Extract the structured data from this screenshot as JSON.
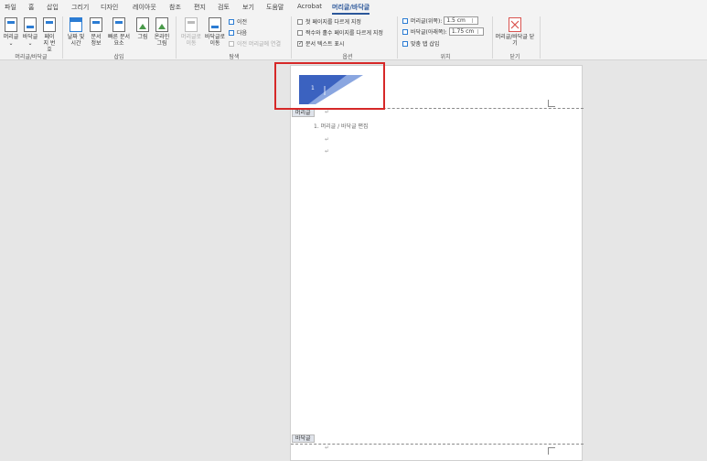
{
  "tabs": [
    "파일",
    "홈",
    "삽입",
    "그리기",
    "디자인",
    "레이아웃",
    "참조",
    "편지",
    "검토",
    "보기",
    "도움말",
    "Acrobat",
    "머리글/바닥글"
  ],
  "active_tab": "머리글/바닥글",
  "ribbon": {
    "groups": {
      "header_footer": {
        "label": "머리글/바닥글",
        "header_label": "머리글",
        "footer_label": "바닥글",
        "page_number_label": "페이지 번호"
      },
      "insert": {
        "label": "삽입",
        "date_time_label": "날짜 및 시간",
        "doc_info_label": "문서 정보",
        "quick_parts_label": "빠른 문서 요소",
        "picture_label": "그림",
        "online_picture_label": "온라인 그림"
      },
      "navigation": {
        "label": "탐색",
        "go_to_header_label": "머리글로 이동",
        "go_to_footer_label": "바닥글로 이동",
        "previous_label": "이전",
        "next_label": "다음",
        "link_previous_label": "이전 머리글에 연결"
      },
      "options": {
        "label": "옵션",
        "different_first_page": {
          "label": "첫 페이지를 다르게 지정",
          "checked": false
        },
        "different_odd_even": {
          "label": "짝수와 홀수 페이지를 다르게 지정",
          "checked": false
        },
        "show_document_text": {
          "label": "문서 텍스트 표시",
          "checked": true
        }
      },
      "position": {
        "label": "위치",
        "header_top_label": "머리글(위쪽):",
        "header_top_value": "1.5 cm",
        "footer_bottom_label": "바닥글(아래쪽):",
        "footer_bottom_value": "1.75 cm",
        "insert_tab_label": "맞춤 탭 삽입"
      },
      "close": {
        "label": "닫기",
        "close_button_label": "머리글/바닥글 닫기"
      }
    }
  },
  "document": {
    "header_tag": "머리글",
    "footer_tag": "바닥글",
    "header_design_number": "1",
    "body_text": "1. 머리글 / 바닥글 편집",
    "colors": {
      "header_dark": "#3b62c0",
      "header_light": "#8aa6e0",
      "highlight": "#d62828",
      "active_tab": "#2b579a"
    }
  }
}
